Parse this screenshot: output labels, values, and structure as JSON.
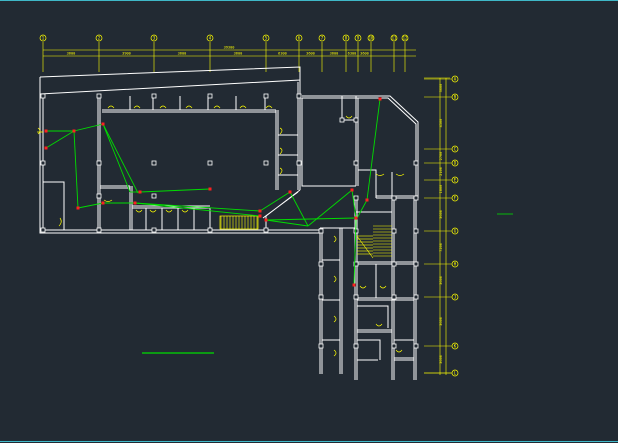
{
  "drawing": {
    "colors": {
      "background": "#222a33",
      "frame": "#3fb8c8",
      "walls": "#ffffff",
      "dimension": "#ffff00",
      "wiring": "#00dd00",
      "device": "#ff2020"
    },
    "top_axis_labels": [
      "1",
      "2",
      "3",
      "4",
      "5",
      "6",
      "7",
      "8",
      "9",
      "10",
      "11",
      "12"
    ],
    "top_dimensions": [
      "3600",
      "3900",
      "3600",
      "3600",
      "6300",
      "3600",
      "3600",
      "6300",
      "3600"
    ],
    "top_overall": "39300",
    "right_axis_labels": [
      "A",
      "B",
      "C",
      "D",
      "E",
      "F",
      "G",
      "H",
      "J",
      "K",
      "L"
    ],
    "right_dimensions": [
      "3600",
      "4500",
      "2700",
      "2100",
      "1800",
      "3600",
      "7200",
      "3600",
      "3600",
      "3600",
      "3600"
    ]
  }
}
